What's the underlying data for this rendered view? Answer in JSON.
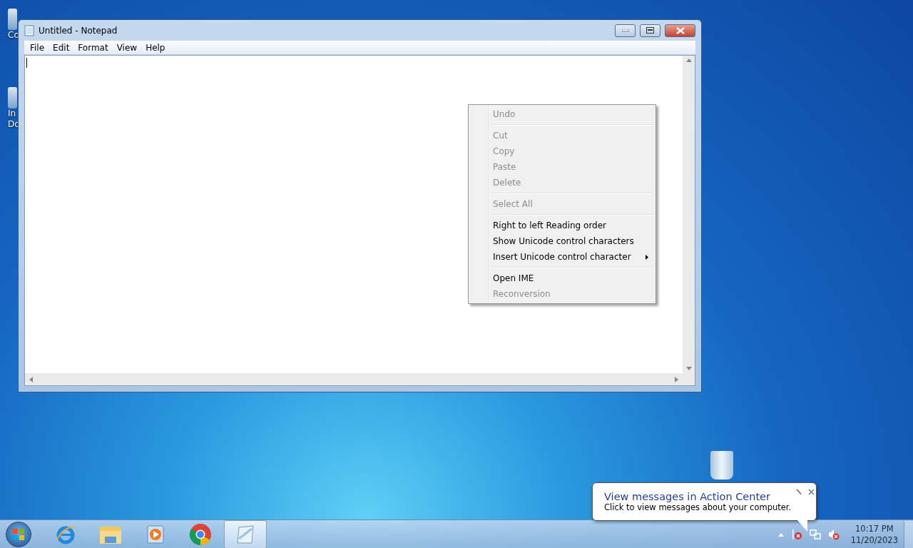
{
  "desktop_icons": [
    {
      "lines": [
        "Co"
      ]
    },
    {
      "lines": [
        "In",
        "Dc"
      ]
    }
  ],
  "window": {
    "title": "Untitled - Notepad",
    "menu": [
      "File",
      "Edit",
      "Format",
      "View",
      "Help"
    ]
  },
  "context_menu": [
    {
      "kind": "item",
      "label": "Undo",
      "disabled": true
    },
    {
      "kind": "separator"
    },
    {
      "kind": "item",
      "label": "Cut",
      "disabled": true
    },
    {
      "kind": "item",
      "label": "Copy",
      "disabled": true
    },
    {
      "kind": "item",
      "label": "Paste",
      "disabled": true
    },
    {
      "kind": "item",
      "label": "Delete",
      "disabled": true
    },
    {
      "kind": "separator"
    },
    {
      "kind": "item",
      "label": "Select All",
      "disabled": true
    },
    {
      "kind": "separator"
    },
    {
      "kind": "item",
      "label": "Right to left Reading order",
      "disabled": false
    },
    {
      "kind": "item",
      "label": "Show Unicode control characters",
      "disabled": false
    },
    {
      "kind": "item",
      "label": "Insert Unicode control character",
      "disabled": false,
      "submenu": true
    },
    {
      "kind": "separator"
    },
    {
      "kind": "item",
      "label": "Open IME",
      "disabled": false
    },
    {
      "kind": "item",
      "label": "Reconversion",
      "disabled": true
    }
  ],
  "notification": {
    "title": "View messages in Action Center",
    "body": "Click to view messages about your computer."
  },
  "taskbar": {
    "apps": [
      {
        "kind": "ie",
        "selected": false
      },
      {
        "kind": "explorer",
        "selected": false
      },
      {
        "kind": "media",
        "selected": false
      },
      {
        "kind": "chrome",
        "selected": false
      },
      {
        "kind": "notepad",
        "selected": true
      }
    ],
    "time": "10:17 PM",
    "date": "11/20/2023"
  }
}
